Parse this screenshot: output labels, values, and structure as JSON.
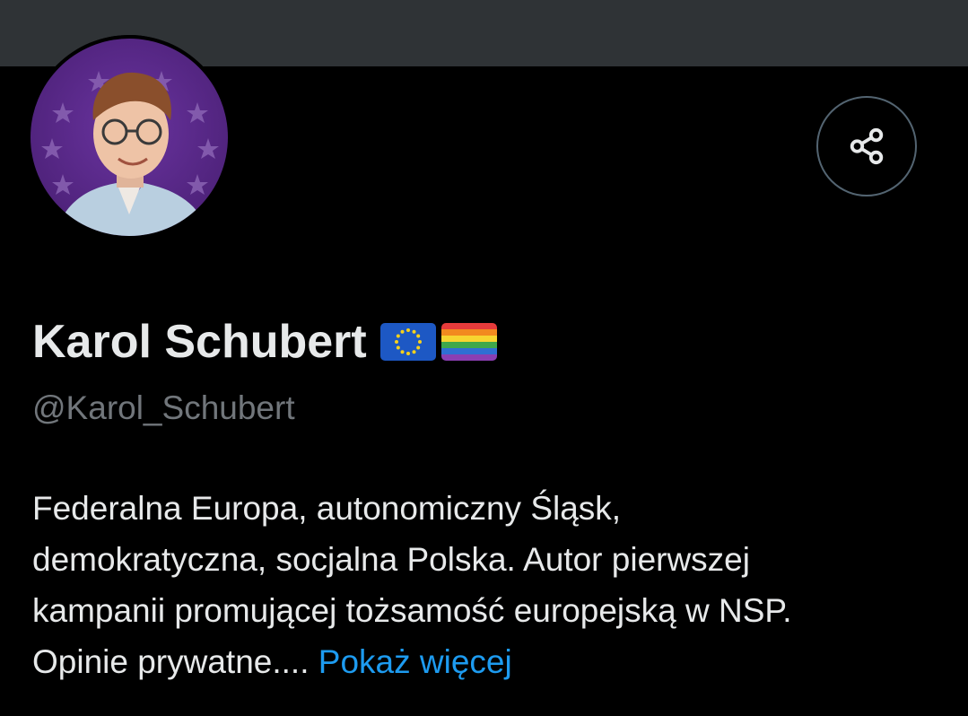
{
  "profile": {
    "display_name": "Karol Schubert",
    "flags": [
      "eu-flag",
      "rainbow-flag"
    ],
    "handle": "@Karol_Schubert",
    "bio_lines": [
      "Federalna Europa, autonomiczny Śląsk,",
      "demokratyczna, socjalna Polska. Autor pierwszej",
      "kampanii promującej tożsamość europejską w NSP.",
      "Opinie prywatne...."
    ],
    "show_more_label": "Pokaż więcej"
  },
  "icons": {
    "share": "share-icon"
  },
  "colors": {
    "background": "#000000",
    "banner": "#2f3336",
    "primary_text": "#e7e9ea",
    "secondary_text": "#71767b",
    "link": "#1d9bf0",
    "avatar_background": "#5b2a86"
  }
}
